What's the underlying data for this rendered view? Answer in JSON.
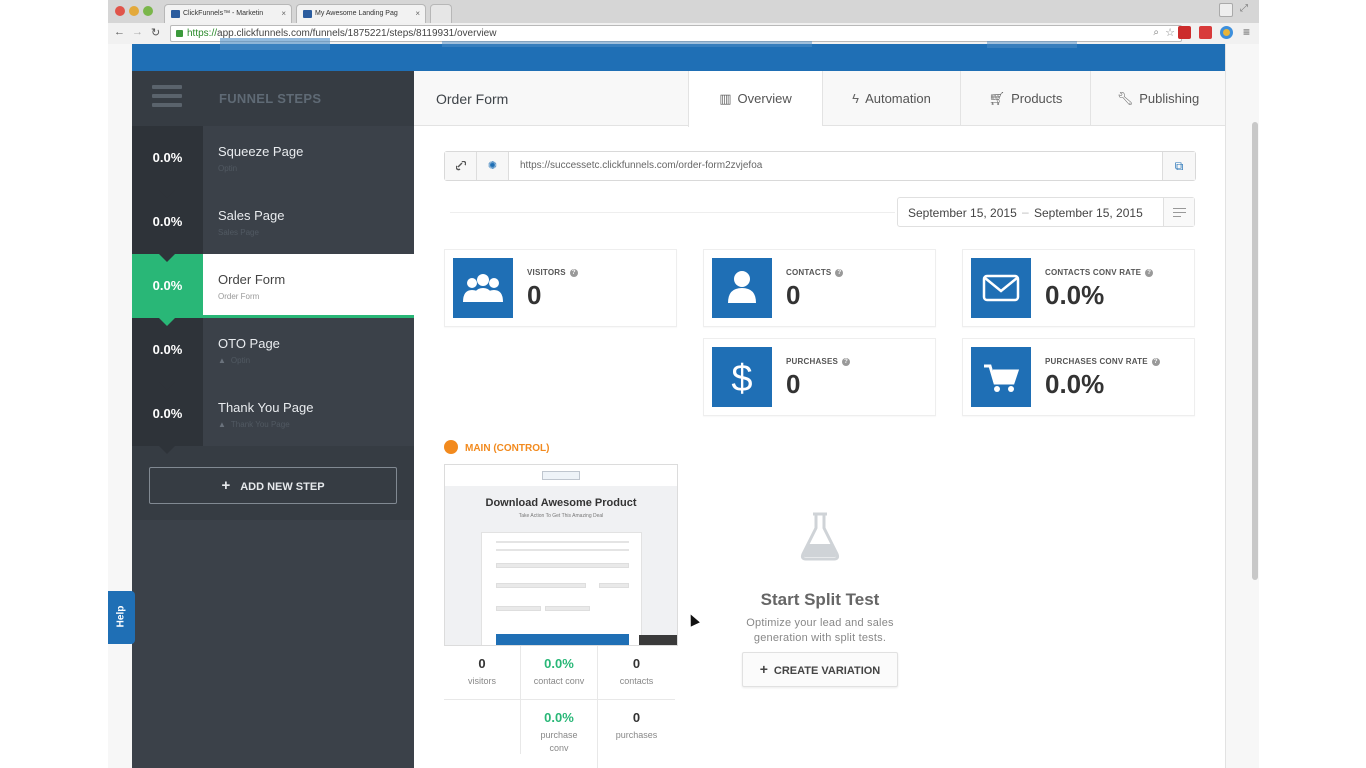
{
  "browser": {
    "tabs": [
      {
        "label": "ClickFunnels™ - Marketin"
      },
      {
        "label": "My Awesome Landing Pag"
      }
    ],
    "url_scheme": "https://",
    "url_rest": "app.clickfunnels.com/funnels/1875221/steps/8119931/overview"
  },
  "sidebar": {
    "title": "FUNNEL STEPS",
    "steps": [
      {
        "pct": "0.0%",
        "name": "Squeeze Page",
        "sub": "Optin",
        "warn": false
      },
      {
        "pct": "0.0%",
        "name": "Sales Page",
        "sub": "Sales Page",
        "warn": false
      },
      {
        "pct": "0.0%",
        "name": "Order Form",
        "sub": "Order Form",
        "warn": false,
        "active": true
      },
      {
        "pct": "0.0%",
        "name": "OTO Page",
        "sub": "Optin",
        "warn": true
      },
      {
        "pct": "0.0%",
        "name": "Thank You Page",
        "sub": "Thank You Page",
        "warn": true
      }
    ],
    "add_step": "ADD NEW STEP"
  },
  "help": "Help",
  "main": {
    "title": "Order Form",
    "tabs": [
      {
        "label": "Overview",
        "icon": "bar-chart-icon"
      },
      {
        "label": "Automation",
        "icon": "bolt-icon"
      },
      {
        "label": "Products",
        "icon": "cart-icon"
      },
      {
        "label": "Publishing",
        "icon": "wrench-icon"
      }
    ],
    "page_url": "https://successetc.clickfunnels.com/order-form2zvjefoa",
    "date_from": "September 15, 2015",
    "date_sep": "–",
    "date_to": "September 15, 2015"
  },
  "stats": {
    "visitors": {
      "label": "VISITORS",
      "value": "0",
      "icon": "users-icon"
    },
    "contacts": {
      "label": "CONTACTS",
      "value": "0",
      "icon": "user-icon"
    },
    "contacts_conv": {
      "label": "CONTACTS CONV RATE",
      "value": "0.0%",
      "icon": "envelope-icon"
    },
    "purchases": {
      "label": "PURCHASES",
      "value": "0",
      "icon": "dollar-icon"
    },
    "purchases_conv": {
      "label": "PURCHASES CONV RATE",
      "value": "0.0%",
      "icon": "cart-icon"
    }
  },
  "variant": {
    "label": "MAIN (CONTROL)",
    "preview_title": "Download Awesome Product",
    "preview_subtitle": "Take Action To Get This Amazing Deal",
    "stats": [
      {
        "value": "0",
        "label": "visitors"
      },
      {
        "value": "0.0%",
        "label": "contact conv"
      },
      {
        "value": "0",
        "label": "contacts"
      },
      {
        "value": "0.0%",
        "label": "purchase conv"
      },
      {
        "value": "0",
        "label": "purchases"
      }
    ]
  },
  "split_test": {
    "title": "Start Split Test",
    "description": "Optimize your lead and sales generation with split tests.",
    "button": "CREATE VARIATION",
    "icon": "flask-icon"
  },
  "colors": {
    "brand_blue": "#1f6fb5",
    "success_green": "#29b777",
    "sidebar_dark": "#3b4149",
    "control_orange": "#f28a1e"
  }
}
